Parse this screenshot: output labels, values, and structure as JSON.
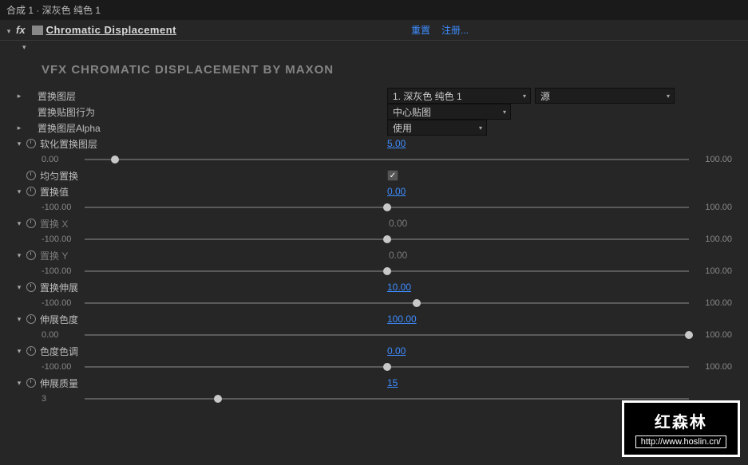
{
  "header": {
    "breadcrumb": "合成 1 · 深灰色 纯色 1"
  },
  "fx": {
    "name": "Chromatic Displacement",
    "reset": "重置",
    "register": "注册...",
    "title": "VFX CHROMATIC DISPLACEMENT BY MAXON"
  },
  "props": {
    "displaceLayer": {
      "label": "置换图层",
      "layer": "1. 深灰色 纯色 1",
      "source": "源"
    },
    "mapBehavior": {
      "label": "置换贴图行为",
      "value": "中心贴图"
    },
    "layerAlpha": {
      "label": "置换图层Alpha",
      "value": "使用"
    },
    "soften": {
      "label": "软化置换图层",
      "value": "5.00",
      "min": "0.00",
      "max": "100.00",
      "pct": 5
    },
    "uniform": {
      "label": "均匀置换",
      "checked": true
    },
    "amount": {
      "label": "置换值",
      "value": "0.00",
      "min": "-100.00",
      "max": "100.00",
      "pct": 50
    },
    "dispX": {
      "label": "置换 X",
      "value": "0.00",
      "min": "-100.00",
      "max": "100.00",
      "pct": 50
    },
    "dispY": {
      "label": "置换 Y",
      "value": "0.00",
      "min": "-100.00",
      "max": "100.00",
      "pct": 50
    },
    "spread": {
      "label": "置换伸展",
      "value": "10.00",
      "min": "-100.00",
      "max": "100.00",
      "pct": 55
    },
    "chroma": {
      "label": "伸展色度",
      "value": "100.00",
      "min": "0.00",
      "max": "100.00",
      "pct": 100
    },
    "hue": {
      "label": "色度色调",
      "value": "0.00",
      "min": "-100.00",
      "max": "100.00",
      "pct": 50
    },
    "quality": {
      "label": "伸展质量",
      "value": "15",
      "min": "3",
      "max": "",
      "pct": 22
    }
  },
  "watermark": {
    "main": "红森林",
    "url": "http://www.hoslin.cn/"
  }
}
